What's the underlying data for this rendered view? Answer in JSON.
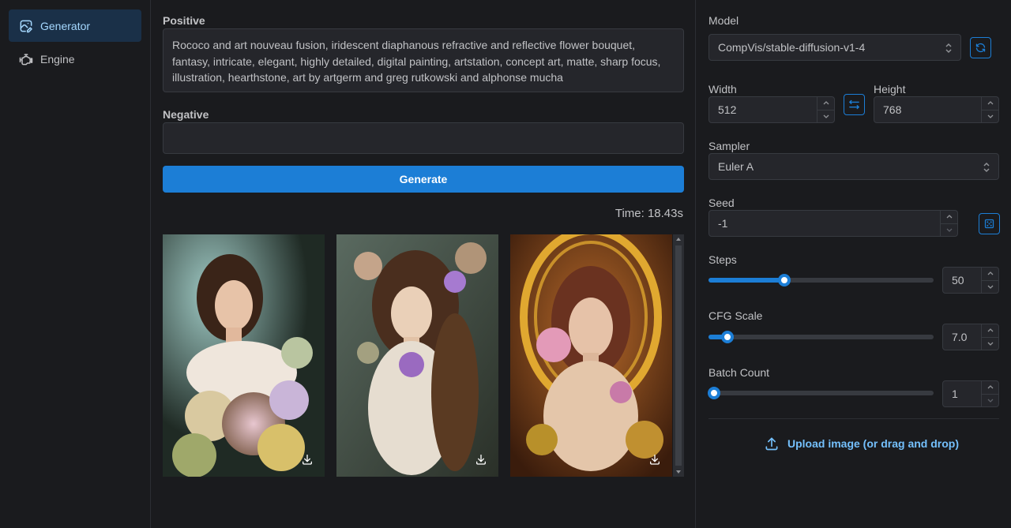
{
  "sidebar": {
    "items": [
      {
        "label": "Generator",
        "icon": "image-edit-icon",
        "active": true
      },
      {
        "label": "Engine",
        "icon": "engine-icon",
        "active": false
      }
    ]
  },
  "main": {
    "positive_label": "Positive",
    "positive_text": "Rococo and art nouveau fusion, iridescent diaphanous refractive and reflective flower bouquet, fantasy, intricate, elegant, highly detailed, digital painting, artstation, concept art, matte, sharp focus, illustration, hearthstone, art by artgerm and greg rutkowski and alphonse mucha",
    "negative_label": "Negative",
    "negative_text": "",
    "generate_label": "Generate",
    "time_text": "Time: 18.43s"
  },
  "panel": {
    "model_label": "Model",
    "model_value": "CompVis/stable-diffusion-v1-4",
    "width_label": "Width",
    "width_value": "512",
    "height_label": "Height",
    "height_value": "768",
    "sampler_label": "Sampler",
    "sampler_value": "Euler A",
    "seed_label": "Seed",
    "seed_value": "-1",
    "steps_label": "Steps",
    "steps_value": "50",
    "cfg_label": "CFG Scale",
    "cfg_value": "7.0",
    "batch_label": "Batch Count",
    "batch_value": "1",
    "upload_label": "Upload image (or drag and drop)"
  },
  "colors": {
    "accent": "#1c7ed6",
    "background": "#1a1b1e",
    "input_bg": "#25262b",
    "link": "#74c0fc"
  }
}
